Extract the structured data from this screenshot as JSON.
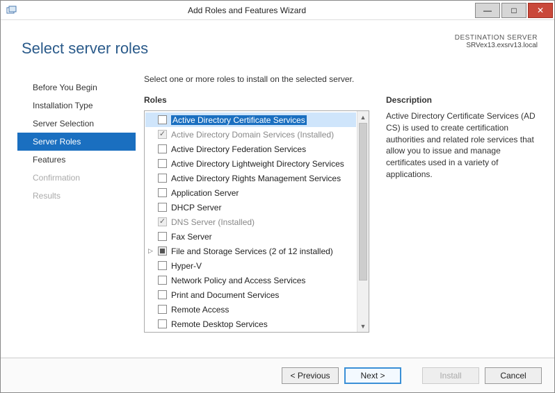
{
  "window": {
    "title": "Add Roles and Features Wizard"
  },
  "destination": {
    "label": "DESTINATION SERVER",
    "value": "SRVex13.exsrv13.local"
  },
  "page": {
    "title": "Select server roles",
    "instruction": "Select one or more roles to install on the selected server."
  },
  "nav": {
    "items": [
      {
        "label": "Before You Begin",
        "state": "normal"
      },
      {
        "label": "Installation Type",
        "state": "normal"
      },
      {
        "label": "Server Selection",
        "state": "normal"
      },
      {
        "label": "Server Roles",
        "state": "selected"
      },
      {
        "label": "Features",
        "state": "normal"
      },
      {
        "label": "Confirmation",
        "state": "disabled"
      },
      {
        "label": "Results",
        "state": "disabled"
      }
    ]
  },
  "sections": {
    "roles_label": "Roles",
    "desc_label": "Description"
  },
  "roles": [
    {
      "label": "Active Directory Certificate Services",
      "checked": false,
      "selected": true
    },
    {
      "label": "Active Directory Domain Services (Installed)",
      "checked": true,
      "installed": true
    },
    {
      "label": "Active Directory Federation Services",
      "checked": false
    },
    {
      "label": "Active Directory Lightweight Directory Services",
      "checked": false
    },
    {
      "label": "Active Directory Rights Management Services",
      "checked": false
    },
    {
      "label": "Application Server",
      "checked": false
    },
    {
      "label": "DHCP Server",
      "checked": false
    },
    {
      "label": "DNS Server (Installed)",
      "checked": true,
      "installed": true
    },
    {
      "label": "Fax Server",
      "checked": false
    },
    {
      "label": "File and Storage Services (2 of 12 installed)",
      "checked": "partial",
      "expandable": true
    },
    {
      "label": "Hyper-V",
      "checked": false
    },
    {
      "label": "Network Policy and Access Services",
      "checked": false
    },
    {
      "label": "Print and Document Services",
      "checked": false
    },
    {
      "label": "Remote Access",
      "checked": false
    },
    {
      "label": "Remote Desktop Services",
      "checked": false
    }
  ],
  "description": {
    "text": "Active Directory Certificate Services (AD CS) is used to create certification authorities and related role services that allow you to issue and manage certificates used in a variety of applications."
  },
  "buttons": {
    "previous": "< Previous",
    "next": "Next >",
    "install": "Install",
    "cancel": "Cancel"
  }
}
